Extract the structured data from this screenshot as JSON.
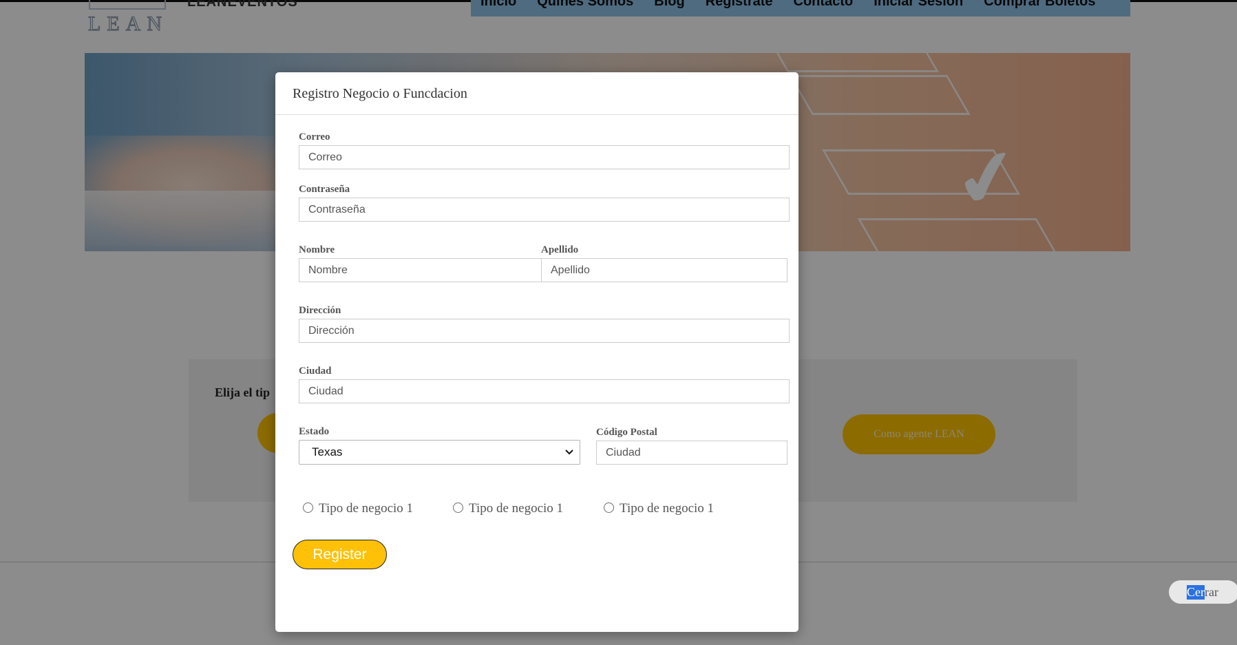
{
  "header": {
    "logo_text": "LEAN",
    "brand": "LEANEVENTOS",
    "nav": [
      "Inicio",
      "Quines Somos",
      "Blog",
      "Registrate",
      "Contacto",
      "Iniciar Sesion",
      "Comprar Boletos"
    ]
  },
  "panel": {
    "title": "Elija el tip",
    "agent_button": "Como agente LEAN"
  },
  "modal": {
    "title": "Registro Negocio o Funcdacion",
    "fields": {
      "correo": {
        "label": "Correo",
        "placeholder": "Correo"
      },
      "contrasena": {
        "label": "Contraseña",
        "placeholder": "Contraseña"
      },
      "nombre": {
        "label": "Nombre",
        "placeholder": "Nombre"
      },
      "apellido": {
        "label": "Apellido",
        "placeholder": "Apellido"
      },
      "direccion": {
        "label": "Dirección",
        "placeholder": "Dirección"
      },
      "ciudad": {
        "label": "Ciudad",
        "placeholder": "Ciudad"
      },
      "estado": {
        "label": "Estado",
        "value": "Texas"
      },
      "codigo_postal": {
        "label": "Código Postal",
        "placeholder": "Ciudad"
      }
    },
    "business_types": [
      "Tipo de negocio 1",
      "Tipo de negocio 1",
      "Tipo de negocio 1"
    ],
    "register_button": "Register"
  },
  "close_button": {
    "selected_part": "Cer",
    "rest": "rar"
  },
  "colors": {
    "accent": "#ffc107",
    "nav_bg": "#8fc3e9",
    "selection": "#2b71e0"
  }
}
